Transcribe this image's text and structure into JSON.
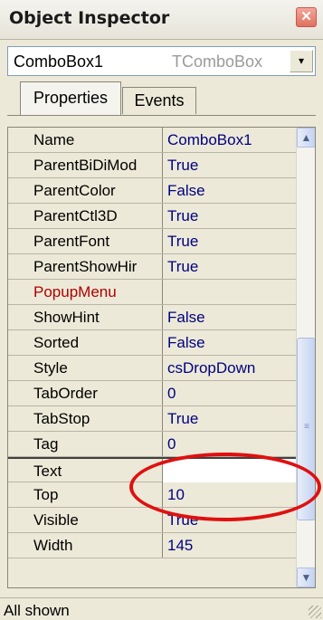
{
  "window": {
    "title": "Object Inspector",
    "close_glyph": "✕"
  },
  "component_selector": {
    "name": "ComboBox1",
    "type": "TComboBox",
    "dropdown_glyph": "▾"
  },
  "tabs": [
    {
      "label": "Properties",
      "active": true
    },
    {
      "label": "Events",
      "active": false
    }
  ],
  "properties": [
    {
      "name": "Name",
      "value": "ComboBox1"
    },
    {
      "name": "ParentBiDiMod",
      "value": "True"
    },
    {
      "name": "ParentColor",
      "value": "False"
    },
    {
      "name": "ParentCtl3D",
      "value": "True"
    },
    {
      "name": "ParentFont",
      "value": "True"
    },
    {
      "name": "ParentShowHir",
      "value": "True"
    },
    {
      "name": "PopupMenu",
      "value": ""
    },
    {
      "name": "ShowHint",
      "value": "False"
    },
    {
      "name": "Sorted",
      "value": "False"
    },
    {
      "name": "Style",
      "value": "csDropDown"
    },
    {
      "name": "TabOrder",
      "value": "0"
    },
    {
      "name": "TabStop",
      "value": "True"
    },
    {
      "name": "Tag",
      "value": "0"
    },
    {
      "name": "Text",
      "value": ""
    },
    {
      "name": "Top",
      "value": "10"
    },
    {
      "name": "Visible",
      "value": "True"
    },
    {
      "name": "Width",
      "value": "145"
    }
  ],
  "scrollbar": {
    "up_glyph": "▲",
    "down_glyph": "▼",
    "grip_glyph": "≡"
  },
  "status": {
    "text": "All shown"
  },
  "colors": {
    "value_text": "#000080",
    "event_property_text": "#b00000",
    "annotation": "#e01010"
  }
}
